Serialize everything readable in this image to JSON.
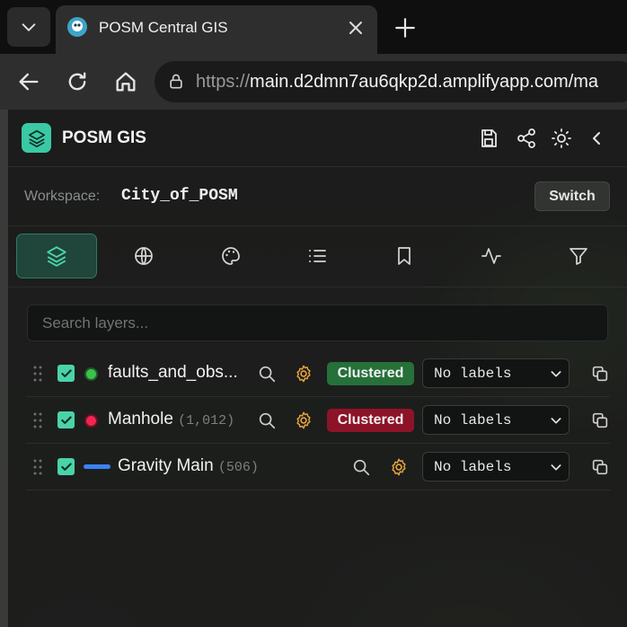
{
  "browser": {
    "tab_title": "POSM Central GIS",
    "url_scheme": "https://",
    "url_host": "main.d2dmn7au6qkp2d.amplifyapp.com/ma",
    "icons": [
      "chevron-down-icon",
      "close-icon",
      "plus-icon",
      "back-arrow-icon",
      "reload-icon",
      "home-icon",
      "lock-icon"
    ]
  },
  "panel": {
    "app_title": "POSM GIS",
    "header_icons": [
      "save-icon",
      "share-icon",
      "sun-icon",
      "chevron-left-icon"
    ],
    "workspace": {
      "label": "Workspace:",
      "value": "City_of_POSM",
      "switch_label": "Switch"
    },
    "tools": [
      {
        "name": "layers",
        "icon": "layers-icon",
        "active": true
      },
      {
        "name": "basemap",
        "icon": "globe-icon",
        "active": false
      },
      {
        "name": "style",
        "icon": "palette-icon",
        "active": false
      },
      {
        "name": "list",
        "icon": "list-icon",
        "active": false
      },
      {
        "name": "bookmarks",
        "icon": "bookmark-icon",
        "active": false
      },
      {
        "name": "activity",
        "icon": "activity-icon",
        "active": false
      },
      {
        "name": "filter",
        "icon": "filter-icon",
        "active": false
      }
    ],
    "search": {
      "placeholder": "Search layers...",
      "value": ""
    },
    "layers": [
      {
        "name": "faults_and_obs...",
        "count": "",
        "symbol": "dot",
        "color": "#3cc24a",
        "checked": true,
        "badge": "Clustered",
        "badge_color": "#26703a",
        "label_mode": "No labels"
      },
      {
        "name": "Manhole",
        "count": "(1,012)",
        "symbol": "dot",
        "color": "#ee2650",
        "checked": true,
        "badge": "Clustered",
        "badge_color": "#8d1328",
        "label_mode": "No labels"
      },
      {
        "name": "Gravity Main",
        "count": "(506)",
        "symbol": "line",
        "color": "#3b82f6",
        "checked": true,
        "badge": "",
        "badge_color": "",
        "label_mode": "No labels"
      }
    ]
  },
  "colors": {
    "accent": "#3ac9a4",
    "settings_icon": "#e7a43a"
  }
}
